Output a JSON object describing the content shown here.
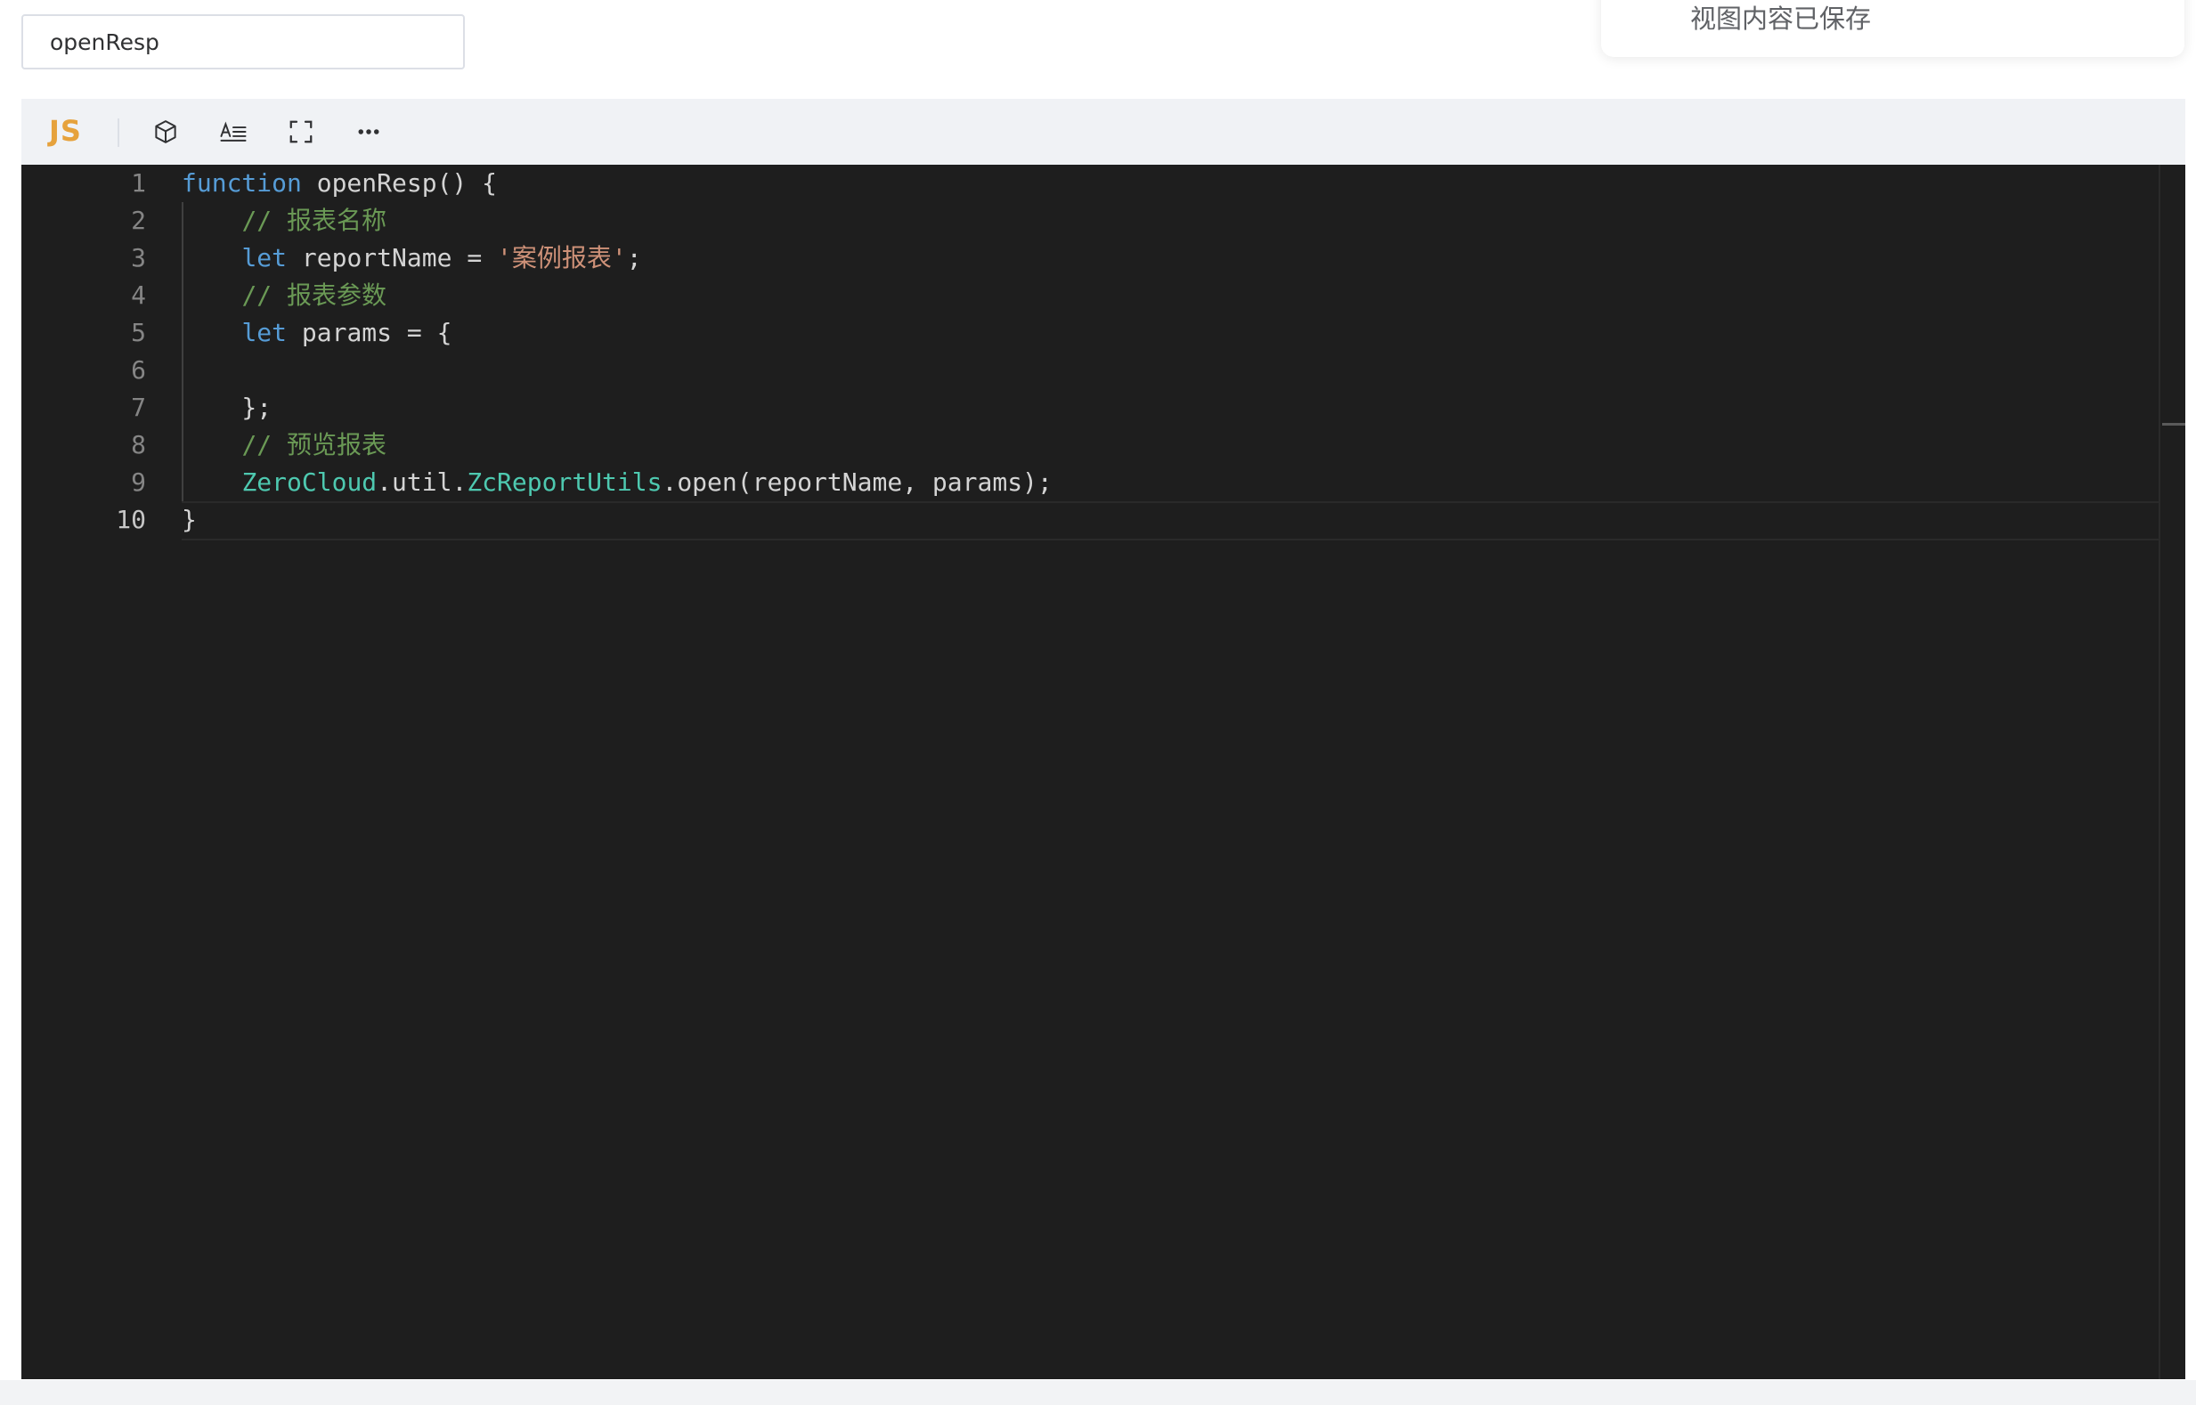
{
  "name_field": {
    "value": "openResp"
  },
  "toast": {
    "message": "视图内容已保存"
  },
  "toolbar": {
    "language": "JS",
    "buttons": [
      "box-icon",
      "format-icon",
      "fullscreen-icon",
      "more-icon"
    ]
  },
  "editor": {
    "active_line": 10,
    "line_numbers": [
      "1",
      "2",
      "3",
      "4",
      "5",
      "6",
      "7",
      "8",
      "9",
      "10"
    ],
    "lines": [
      [
        {
          "t": "kw",
          "v": "function"
        },
        {
          "t": "id",
          "v": " openResp"
        },
        {
          "t": "pn",
          "v": "() {"
        }
      ],
      [
        {
          "t": "pn",
          "v": "    "
        },
        {
          "t": "cm",
          "v": "// 报表名称"
        }
      ],
      [
        {
          "t": "pn",
          "v": "    "
        },
        {
          "t": "kw",
          "v": "let"
        },
        {
          "t": "id",
          "v": " reportName "
        },
        {
          "t": "pn",
          "v": "= "
        },
        {
          "t": "st",
          "v": "'案例报表'"
        },
        {
          "t": "pn",
          "v": ";"
        }
      ],
      [
        {
          "t": "pn",
          "v": "    "
        },
        {
          "t": "cm",
          "v": "// 报表参数"
        }
      ],
      [
        {
          "t": "pn",
          "v": "    "
        },
        {
          "t": "kw",
          "v": "let"
        },
        {
          "t": "id",
          "v": " params "
        },
        {
          "t": "pn",
          "v": "= {"
        }
      ],
      [],
      [
        {
          "t": "pn",
          "v": "    };"
        }
      ],
      [
        {
          "t": "pn",
          "v": "    "
        },
        {
          "t": "cm",
          "v": "// 预览报表"
        }
      ],
      [
        {
          "t": "pn",
          "v": "    "
        },
        {
          "t": "ty",
          "v": "ZeroCloud"
        },
        {
          "t": "pn",
          "v": ".util."
        },
        {
          "t": "ty",
          "v": "ZcReportUtils"
        },
        {
          "t": "pn",
          "v": ".open(reportName, params);"
        }
      ],
      [
        {
          "t": "pn",
          "v": "}"
        }
      ]
    ]
  },
  "colors": {
    "editor_bg": "#1e1e1e",
    "toolbar_bg": "#f0f2f5",
    "lang_badge": "#e6a23c",
    "keyword": "#569cd6",
    "comment": "#6a9955",
    "string": "#ce9178",
    "type": "#4ec9b0"
  }
}
